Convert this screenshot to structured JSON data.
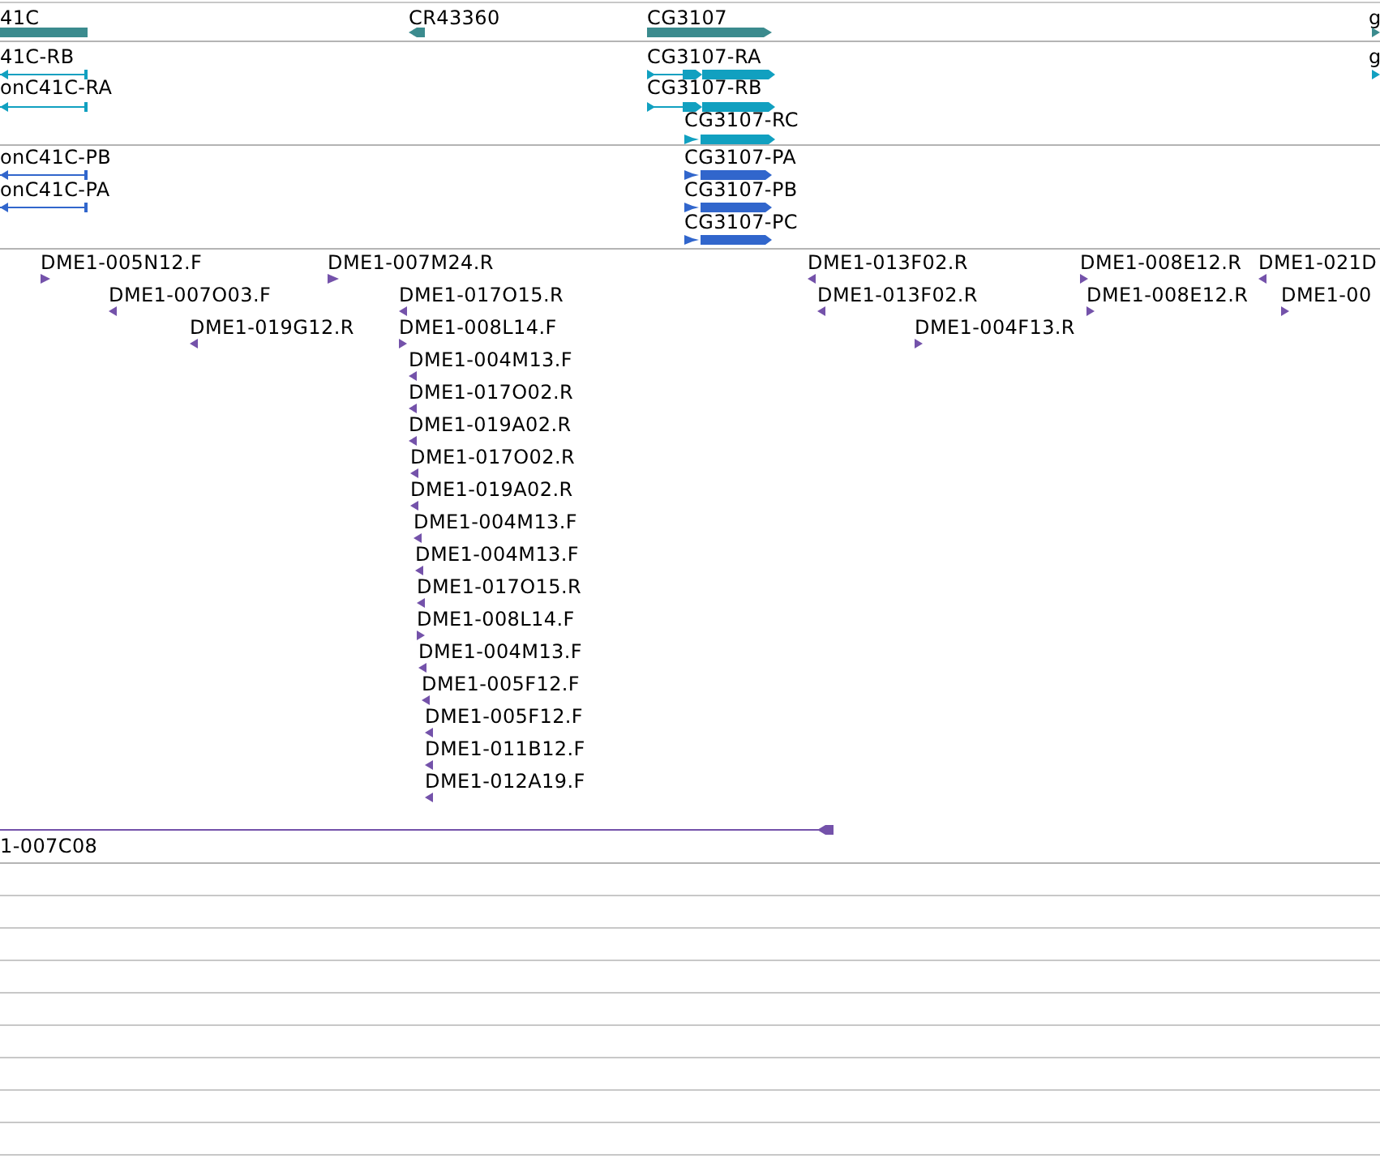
{
  "tracks": [
    {
      "kind": "genes",
      "color": "#3b8b8e",
      "features": [
        {
          "label": "41C"
        },
        {
          "label": "CR43360",
          "reverse": true
        },
        {
          "label": "CG3107",
          "reverse": false
        },
        {
          "label": "g",
          "reverse": false
        }
      ]
    },
    {
      "kind": "transcripts",
      "color": "#11a0c0",
      "features": [
        {
          "label": "41C-RB",
          "reverse": true
        },
        {
          "label": "onC41C-RA",
          "reverse": true
        },
        {
          "label": "CG3107-RA",
          "reverse": false
        },
        {
          "label": "CG3107-RB",
          "reverse": false
        },
        {
          "label": "CG3107-RC",
          "reverse": false
        },
        {
          "label": "g",
          "reverse": false
        }
      ]
    },
    {
      "kind": "proteins",
      "color": "#3166cc",
      "features": [
        {
          "label": "onC41C-PB",
          "reverse": true
        },
        {
          "label": "onC41C-PA",
          "reverse": true
        },
        {
          "label": "CG3107-PA",
          "reverse": false
        },
        {
          "label": "CG3107-PB",
          "reverse": false
        },
        {
          "label": "CG3107-PC",
          "reverse": false
        }
      ]
    },
    {
      "kind": "clones",
      "color": "#7452aa",
      "features": [
        {
          "label": "DME1-005N12.F",
          "reverse": false
        },
        {
          "label": "DME1-007M24.R",
          "reverse": false
        },
        {
          "label": "DME1-013F02.R",
          "reverse": true
        },
        {
          "label": "DME1-008E12.R",
          "reverse": false
        },
        {
          "label": "DME1-021D",
          "reverse": true
        },
        {
          "label": "DME1-007O03.F",
          "reverse": true
        },
        {
          "label": "DME1-017O15.R",
          "reverse": true
        },
        {
          "label": "DME1-013F02.R",
          "reverse": true
        },
        {
          "label": "DME1-008E12.R",
          "reverse": false
        },
        {
          "label": "DME1-00",
          "reverse": false
        },
        {
          "label": "DME1-019G12.R",
          "reverse": true
        },
        {
          "label": "DME1-008L14.F",
          "reverse": false
        },
        {
          "label": "DME1-004F13.R",
          "reverse": false
        },
        {
          "label": "DME1-004M13.F",
          "reverse": true
        },
        {
          "label": "DME1-017O02.R",
          "reverse": true
        },
        {
          "label": "DME1-019A02.R",
          "reverse": true
        },
        {
          "label": "DME1-017O02.R",
          "reverse": true
        },
        {
          "label": "DME1-019A02.R",
          "reverse": true
        },
        {
          "label": "DME1-004M13.F",
          "reverse": true
        },
        {
          "label": "DME1-004M13.F",
          "reverse": true
        },
        {
          "label": "DME1-017O15.R",
          "reverse": true
        },
        {
          "label": "DME1-008L14.F",
          "reverse": false
        },
        {
          "label": "DME1-004M13.F",
          "reverse": true
        },
        {
          "label": "DME1-005F12.F",
          "reverse": true
        },
        {
          "label": "DME1-005F12.F",
          "reverse": true
        },
        {
          "label": "DME1-011B12.F",
          "reverse": true
        },
        {
          "label": "DME1-012A19.F",
          "reverse": true
        },
        {
          "label": "1-007C08",
          "reverse": true
        }
      ]
    }
  ]
}
